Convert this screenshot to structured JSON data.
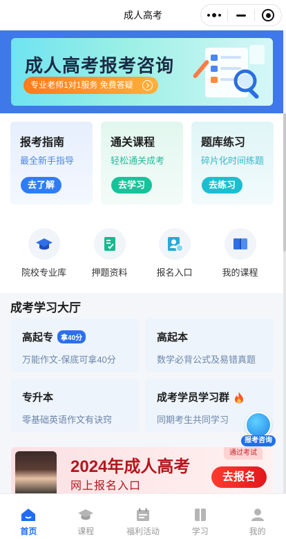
{
  "nav": {
    "title": "成人高考"
  },
  "hero": {
    "title": "成人高考报考咨询",
    "pill": "专业老师1对1服务 免费答疑"
  },
  "features": [
    {
      "title": "报考指南",
      "subtitle": "最全新手指导",
      "button": "去了解"
    },
    {
      "title": "通关课程",
      "subtitle": "轻松通关成考",
      "button": "去学习"
    },
    {
      "title": "题库练习",
      "subtitle": "碎片化时间练题",
      "button": "去练习"
    }
  ],
  "quick_links": [
    {
      "label": "院校专业库",
      "icon": "graduation-cap-icon"
    },
    {
      "label": "押题资料",
      "icon": "document-check-icon"
    },
    {
      "label": "报名入口",
      "icon": "user-register-icon"
    },
    {
      "label": "我的课程",
      "icon": "book-icon"
    }
  ],
  "hall": {
    "title": "成考学习大厅",
    "cards": [
      {
        "title": "高起专",
        "tag": "拿40分",
        "subtitle": "万能作文-保底可拿40分"
      },
      {
        "title": "高起本",
        "subtitle": "数学必背公式及易错真题"
      },
      {
        "title": "专升本",
        "subtitle": "零基础英语作文有诀窍"
      },
      {
        "title": "成考学员学习群",
        "subtitle": "同期考生共同学习",
        "icon": "fire-icon"
      }
    ]
  },
  "consult": {
    "label": "报考咨询"
  },
  "promo": {
    "title": "2024年成人高考",
    "subtitle": "网上报名入口",
    "tag": "通过考试",
    "button": "去报名"
  },
  "tabs": [
    {
      "label": "首页",
      "icon": "home-icon",
      "active": true
    },
    {
      "label": "课程",
      "icon": "graduation-cap-icon",
      "active": false
    },
    {
      "label": "福利活动",
      "icon": "calendar-icon",
      "active": false
    },
    {
      "label": "学习",
      "icon": "book-icon",
      "active": false
    },
    {
      "label": "我的",
      "icon": "user-icon",
      "active": false
    }
  ],
  "colors": {
    "accent": "#1e6ef0",
    "hero_bg": "#3f78e8",
    "promo_red": "#b3161c"
  }
}
